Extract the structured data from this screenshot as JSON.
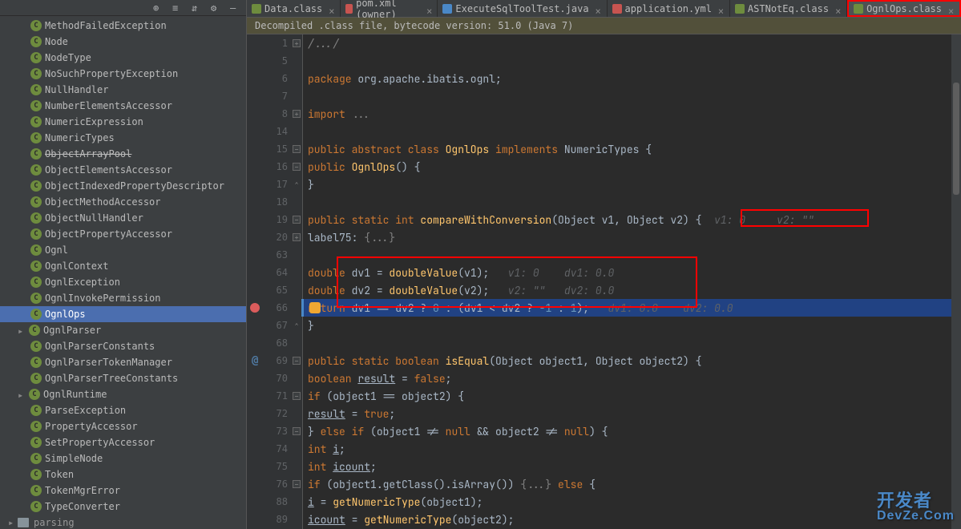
{
  "toolbar": {
    "icons": [
      "target-icon",
      "sort-icon",
      "filter-icon",
      "settings-icon",
      "collapse-icon"
    ]
  },
  "sidebar": {
    "items": [
      {
        "label": "MethodFailedException",
        "type": "class"
      },
      {
        "label": "Node",
        "type": "interface"
      },
      {
        "label": "NodeType",
        "type": "interface"
      },
      {
        "label": "NoSuchPropertyException",
        "type": "class"
      },
      {
        "label": "NullHandler",
        "type": "interface"
      },
      {
        "label": "NumberElementsAccessor",
        "type": "class"
      },
      {
        "label": "NumericExpression",
        "type": "class"
      },
      {
        "label": "NumericTypes",
        "type": "interface"
      },
      {
        "label": "ObjectArrayPool",
        "type": "class",
        "strikethrough": true
      },
      {
        "label": "ObjectElementsAccessor",
        "type": "class"
      },
      {
        "label": "ObjectIndexedPropertyDescriptor",
        "type": "class"
      },
      {
        "label": "ObjectMethodAccessor",
        "type": "class"
      },
      {
        "label": "ObjectNullHandler",
        "type": "class"
      },
      {
        "label": "ObjectPropertyAccessor",
        "type": "class"
      },
      {
        "label": "Ognl",
        "type": "class"
      },
      {
        "label": "OgnlContext",
        "type": "class"
      },
      {
        "label": "OgnlException",
        "type": "class"
      },
      {
        "label": "OgnlInvokePermission",
        "type": "class"
      },
      {
        "label": "OgnlOps",
        "type": "class",
        "selected": true
      },
      {
        "label": "OgnlParser",
        "type": "class",
        "expandable": true
      },
      {
        "label": "OgnlParserConstants",
        "type": "interface"
      },
      {
        "label": "OgnlParserTokenManager",
        "type": "class"
      },
      {
        "label": "OgnlParserTreeConstants",
        "type": "interface"
      },
      {
        "label": "OgnlRuntime",
        "type": "class",
        "expandable": true
      },
      {
        "label": "ParseException",
        "type": "class"
      },
      {
        "label": "PropertyAccessor",
        "type": "interface"
      },
      {
        "label": "SetPropertyAccessor",
        "type": "class"
      },
      {
        "label": "SimpleNode",
        "type": "class"
      },
      {
        "label": "Token",
        "type": "class"
      },
      {
        "label": "TokenMgrError",
        "type": "class"
      },
      {
        "label": "TypeConverter",
        "type": "interface"
      }
    ],
    "folder": "parsing"
  },
  "tabs": [
    {
      "label": "Data.class",
      "icon": "java-class"
    },
    {
      "label": "pom.xml (owner)",
      "icon": "maven"
    },
    {
      "label": "ExecuteSqlToolTest.java",
      "icon": "java"
    },
    {
      "label": "application.yml",
      "icon": "yaml"
    },
    {
      "label": "ASTNotEq.class",
      "icon": "java-class"
    },
    {
      "label": "OgnlOps.class",
      "icon": "java-class",
      "active": true,
      "highlighted": true
    }
  ],
  "banner": "Decompiled .class file, bytecode version: 51.0 (Java 7)",
  "code": {
    "lines": [
      {
        "num": 1,
        "fold": "+",
        "content": [
          {
            "t": "comment",
            "v": "/.../"
          }
        ]
      },
      {
        "num": 5,
        "content": []
      },
      {
        "num": 6,
        "content": [
          {
            "t": "kw",
            "v": "package "
          },
          {
            "t": "id",
            "v": "org.apache.ibatis.ognl"
          },
          {
            "t": "punct",
            "v": ";"
          }
        ]
      },
      {
        "num": 7,
        "content": []
      },
      {
        "num": 8,
        "fold": "+",
        "content": [
          {
            "t": "kw",
            "v": "import "
          },
          {
            "t": "folded",
            "v": "..."
          }
        ]
      },
      {
        "num": 14,
        "content": []
      },
      {
        "num": 15,
        "fold": "-",
        "content": [
          {
            "t": "kw",
            "v": "public abstract class "
          },
          {
            "t": "fn",
            "v": "OgnlOps"
          },
          {
            "t": "kw",
            "v": " implements "
          },
          {
            "t": "type",
            "v": "NumericTypes"
          },
          {
            "t": "punct",
            "v": " {"
          }
        ]
      },
      {
        "num": 16,
        "fold": "-",
        "indent": 1,
        "content": [
          {
            "t": "kw",
            "v": "public "
          },
          {
            "t": "fn",
            "v": "OgnlOps"
          },
          {
            "t": "punct",
            "v": "() {"
          }
        ]
      },
      {
        "num": 17,
        "fold": "^",
        "indent": 1,
        "content": [
          {
            "t": "punct",
            "v": "}"
          }
        ]
      },
      {
        "num": 18,
        "content": []
      },
      {
        "num": 19,
        "fold": "-",
        "indent": 1,
        "content": [
          {
            "t": "kw",
            "v": "public static int "
          },
          {
            "t": "fn",
            "v": "compareWithConversion"
          },
          {
            "t": "punct",
            "v": "(Object "
          },
          {
            "t": "id",
            "v": "v1"
          },
          {
            "t": "punct",
            "v": ", Object "
          },
          {
            "t": "id",
            "v": "v2"
          },
          {
            "t": "punct",
            "v": ") {"
          }
        ],
        "hint": "  v1: 0     v2: \"\""
      },
      {
        "num": 20,
        "fold": "+",
        "indent": 2,
        "content": [
          {
            "t": "id",
            "v": "label75: "
          },
          {
            "t": "folded",
            "v": "{...}"
          }
        ]
      },
      {
        "num": 63,
        "content": []
      },
      {
        "num": 64,
        "indent": 2,
        "content": [
          {
            "t": "kw",
            "v": "double "
          },
          {
            "t": "id",
            "v": "dv1"
          },
          {
            "t": "punct",
            "v": " = "
          },
          {
            "t": "fn",
            "v": "doubleValue"
          },
          {
            "t": "punct",
            "v": "("
          },
          {
            "t": "id",
            "v": "v1"
          },
          {
            "t": "punct",
            "v": ");"
          }
        ],
        "hint": "   v1: 0    dv1: 0.0"
      },
      {
        "num": 65,
        "indent": 2,
        "content": [
          {
            "t": "kw",
            "v": "double "
          },
          {
            "t": "id",
            "v": "dv2"
          },
          {
            "t": "punct",
            "v": " = "
          },
          {
            "t": "fn",
            "v": "doubleValue"
          },
          {
            "t": "punct",
            "v": "("
          },
          {
            "t": "id",
            "v": "v2"
          },
          {
            "t": "punct",
            "v": ");"
          }
        ],
        "hint": "   v2: \"\"   dv2: 0.0"
      },
      {
        "num": 66,
        "indent": 2,
        "current": true,
        "breakpoint": true,
        "bulb": true,
        "content": [
          {
            "t": "kw",
            "v": "return "
          },
          {
            "t": "id",
            "v": "dv1"
          },
          {
            "t": "punct",
            "v": " == "
          },
          {
            "t": "id",
            "v": "dv2"
          },
          {
            "t": "punct",
            "v": " ? "
          },
          {
            "t": "num",
            "v": "0"
          },
          {
            "t": "punct",
            "v": " : ("
          },
          {
            "t": "id",
            "v": "dv1"
          },
          {
            "t": "punct",
            "v": " < "
          },
          {
            "t": "id",
            "v": "dv2"
          },
          {
            "t": "punct",
            "v": " ? "
          },
          {
            "t": "num",
            "v": "-1"
          },
          {
            "t": "punct",
            "v": " : "
          },
          {
            "t": "num",
            "v": "1"
          },
          {
            "t": "punct",
            "v": ");"
          }
        ],
        "hint": "   dv1: 0.0    dv2: 0.0"
      },
      {
        "num": 67,
        "fold": "^",
        "indent": 1,
        "content": [
          {
            "t": "punct",
            "v": "}"
          }
        ]
      },
      {
        "num": 68,
        "content": []
      },
      {
        "num": 69,
        "fold": "-",
        "indent": 1,
        "override": "@",
        "content": [
          {
            "t": "kw",
            "v": "public static boolean "
          },
          {
            "t": "fn",
            "v": "isEqual"
          },
          {
            "t": "punct",
            "v": "(Object "
          },
          {
            "t": "id",
            "v": "object1"
          },
          {
            "t": "punct",
            "v": ", Object "
          },
          {
            "t": "id",
            "v": "object2"
          },
          {
            "t": "punct",
            "v": ") {"
          }
        ]
      },
      {
        "num": 70,
        "indent": 2,
        "content": [
          {
            "t": "kw",
            "v": "boolean "
          },
          {
            "t": "id underline",
            "v": "result"
          },
          {
            "t": "punct",
            "v": " = "
          },
          {
            "t": "kw",
            "v": "false"
          },
          {
            "t": "punct",
            "v": ";"
          }
        ]
      },
      {
        "num": 71,
        "fold": "-",
        "indent": 2,
        "content": [
          {
            "t": "kw",
            "v": "if "
          },
          {
            "t": "punct",
            "v": "("
          },
          {
            "t": "id",
            "v": "object1"
          },
          {
            "t": "punct",
            "v": " == "
          },
          {
            "t": "id",
            "v": "object2"
          },
          {
            "t": "punct",
            "v": ") {"
          }
        ]
      },
      {
        "num": 72,
        "indent": 3,
        "content": [
          {
            "t": "id underline",
            "v": "result"
          },
          {
            "t": "punct",
            "v": " = "
          },
          {
            "t": "kw",
            "v": "true"
          },
          {
            "t": "punct",
            "v": ";"
          }
        ]
      },
      {
        "num": 73,
        "fold": "-",
        "indent": 2,
        "content": [
          {
            "t": "punct",
            "v": "} "
          },
          {
            "t": "kw",
            "v": "else if "
          },
          {
            "t": "punct",
            "v": "("
          },
          {
            "t": "id",
            "v": "object1"
          },
          {
            "t": "punct",
            "v": " != "
          },
          {
            "t": "kw",
            "v": "null"
          },
          {
            "t": "punct",
            "v": " && "
          },
          {
            "t": "id",
            "v": "object2"
          },
          {
            "t": "punct",
            "v": " != "
          },
          {
            "t": "kw",
            "v": "null"
          },
          {
            "t": "punct",
            "v": ") {"
          }
        ]
      },
      {
        "num": 74,
        "indent": 3,
        "content": [
          {
            "t": "kw",
            "v": "int "
          },
          {
            "t": "id underline",
            "v": "i"
          },
          {
            "t": "punct",
            "v": ";"
          }
        ]
      },
      {
        "num": 75,
        "indent": 3,
        "content": [
          {
            "t": "kw",
            "v": "int "
          },
          {
            "t": "id underline",
            "v": "icount"
          },
          {
            "t": "punct",
            "v": ";"
          }
        ]
      },
      {
        "num": 76,
        "fold": "-",
        "indent": 3,
        "content": [
          {
            "t": "kw",
            "v": "if "
          },
          {
            "t": "punct",
            "v": "("
          },
          {
            "t": "id",
            "v": "object1"
          },
          {
            "t": "punct",
            "v": ".getClass().isArray()) "
          },
          {
            "t": "folded",
            "v": "{...}"
          },
          {
            "t": "kw",
            "v": " else "
          },
          {
            "t": "punct",
            "v": "{"
          }
        ]
      },
      {
        "num": 88,
        "indent": 4,
        "content": [
          {
            "t": "id underline",
            "v": "i"
          },
          {
            "t": "punct",
            "v": " = "
          },
          {
            "t": "fn",
            "v": "getNumericType"
          },
          {
            "t": "punct",
            "v": "("
          },
          {
            "t": "id",
            "v": "object1"
          },
          {
            "t": "punct",
            "v": ");"
          }
        ]
      },
      {
        "num": 89,
        "indent": 4,
        "content": [
          {
            "t": "id underline",
            "v": "icount"
          },
          {
            "t": "punct",
            "v": " = "
          },
          {
            "t": "fn",
            "v": "getNumericType"
          },
          {
            "t": "punct",
            "v": "("
          },
          {
            "t": "id",
            "v": "object2"
          },
          {
            "t": "punct",
            "v": ");"
          }
        ]
      }
    ]
  },
  "watermark": {
    "line1": "开发者",
    "line2": "DevZe.Com"
  }
}
